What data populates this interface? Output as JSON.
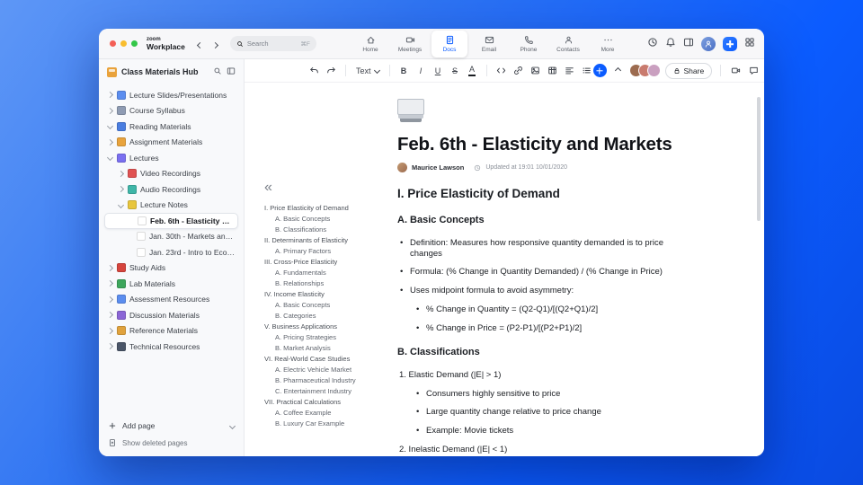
{
  "topbar": {
    "logo_top": "zoom",
    "logo_bottom": "Workplace",
    "search_placeholder": "Search",
    "search_shortcut": "⌘F",
    "traffic_lights": [
      {
        "name": "close",
        "color": "#f45f56"
      },
      {
        "name": "minimize",
        "color": "#f8bd2e"
      },
      {
        "name": "zoom",
        "color": "#33c748"
      }
    ],
    "tabs": [
      {
        "label": "Home",
        "icon": "home-icon",
        "active": false
      },
      {
        "label": "Meetings",
        "icon": "meetings-icon",
        "active": false
      },
      {
        "label": "Docs",
        "icon": "docs-icon",
        "active": true
      },
      {
        "label": "Email",
        "icon": "email-icon",
        "active": false
      },
      {
        "label": "Phone",
        "icon": "phone-icon",
        "active": false
      },
      {
        "label": "Contacts",
        "icon": "contacts-icon",
        "active": false
      },
      {
        "label": "More",
        "icon": "more-icon",
        "active": false
      }
    ],
    "accent": "#0b5cff"
  },
  "sidebar": {
    "title": "Class Materials Hub",
    "items": [
      {
        "label": "Lecture Slides/Presentations",
        "level": 0,
        "expandable": true,
        "expanded": false,
        "icon": "presentation-icon",
        "icon_color": "#5b8def"
      },
      {
        "label": "Course Syllabus",
        "level": 0,
        "expandable": true,
        "expanded": false,
        "icon": "syllabus-icon",
        "icon_color": "#8e9bb3"
      },
      {
        "label": "Reading Materials",
        "level": 0,
        "expandable": true,
        "expanded": true,
        "icon": "book-icon",
        "icon_color": "#4a7de0"
      },
      {
        "label": "Assignment Materials",
        "level": 0,
        "expandable": true,
        "expanded": false,
        "icon": "assignment-icon",
        "icon_color": "#e8a33d"
      },
      {
        "label": "Lectures",
        "level": 0,
        "expandable": true,
        "expanded": true,
        "icon": "lectures-icon",
        "icon_color": "#7a6ff0"
      },
      {
        "label": "Video Recordings",
        "level": 1,
        "expandable": true,
        "expanded": false,
        "icon": "video-icon",
        "icon_color": "#e05252"
      },
      {
        "label": "Audio Recordings",
        "level": 1,
        "expandable": true,
        "expanded": false,
        "icon": "audio-icon",
        "icon_color": "#3fb6a8"
      },
      {
        "label": "Lecture Notes",
        "level": 1,
        "expandable": true,
        "expanded": true,
        "icon": "notes-icon",
        "icon_color": "#e8c63d"
      },
      {
        "label": "Feb. 6th - Elasticity and M...",
        "level": 2,
        "selected": true,
        "icon": "page-icon",
        "icon_color": "#ffffff"
      },
      {
        "label": "Jan. 30th - Markets and P...",
        "level": 2,
        "icon": "page-icon",
        "icon_color": "#ffffff"
      },
      {
        "label": "Jan. 23rd - Intro to Econo...",
        "level": 2,
        "icon": "page-icon",
        "icon_color": "#ffffff"
      },
      {
        "label": "Study Aids",
        "level": 0,
        "expandable": true,
        "expanded": false,
        "icon": "study-icon",
        "icon_color": "#d6453d"
      },
      {
        "label": "Lab Materials",
        "level": 0,
        "expandable": true,
        "expanded": false,
        "icon": "lab-icon",
        "icon_color": "#3da65c"
      },
      {
        "label": "Assessment Resources",
        "level": 0,
        "expandable": true,
        "expanded": false,
        "icon": "assessment-icon",
        "icon_color": "#5b8def"
      },
      {
        "label": "Discussion Materials",
        "level": 0,
        "expandable": true,
        "expanded": false,
        "icon": "discussion-icon",
        "icon_color": "#8a65d6"
      },
      {
        "label": "Reference Materials",
        "level": 0,
        "expandable": true,
        "expanded": false,
        "icon": "reference-icon",
        "icon_color": "#e0a23d"
      },
      {
        "label": "Technical Resources",
        "level": 0,
        "expandable": true,
        "expanded": false,
        "icon": "technical-icon",
        "icon_color": "#4a5568"
      }
    ],
    "footer": {
      "add_page": "Add page",
      "show_deleted": "Show deleted pages"
    }
  },
  "doc_toolbar": {
    "text_style_label": "Text",
    "bold_label": "B",
    "italic_label": "I",
    "underline_label": "U",
    "strike_label": "S",
    "color_label": "A",
    "share_label": "Share",
    "collaborators": [
      {
        "name": "collaborator-1",
        "color": "#9c6b4f"
      },
      {
        "name": "collaborator-2",
        "color": "#c97b6e"
      },
      {
        "name": "collaborator-3",
        "color": "#caa0c0"
      }
    ]
  },
  "outline": {
    "collapse_icon": "«",
    "items": [
      {
        "label": "I. Price Elasticity of Demand",
        "level": 0
      },
      {
        "label": "A. Basic Concepts",
        "level": 1
      },
      {
        "label": "B. Classifications",
        "level": 1
      },
      {
        "label": "II. Determinants of Elasticity",
        "level": 0
      },
      {
        "label": "A. Primary Factors",
        "level": 1
      },
      {
        "label": "III. Cross-Price Elasticity",
        "level": 0
      },
      {
        "label": "A. Fundamentals",
        "level": 1
      },
      {
        "label": "B. Relationships",
        "level": 1
      },
      {
        "label": "IV. Income Elasticity",
        "level": 0
      },
      {
        "label": "A. Basic Concepts",
        "level": 1
      },
      {
        "label": "B. Categories",
        "level": 1
      },
      {
        "label": "V. Business Applications",
        "level": 0
      },
      {
        "label": "A. Pricing Strategies",
        "level": 1
      },
      {
        "label": "B. Market Analysis",
        "level": 1
      },
      {
        "label": "VI. Real-World Case Studies",
        "level": 0
      },
      {
        "label": "A. Electric Vehicle Market",
        "level": 1
      },
      {
        "label": "B. Pharmaceutical Industry",
        "level": 1
      },
      {
        "label": "C. Entertainment Industry",
        "level": 1
      },
      {
        "label": "VII. Practical Calculations",
        "level": 0
      },
      {
        "label": "A. Coffee Example",
        "level": 1
      },
      {
        "label": "B. Luxury Car Example",
        "level": 1
      }
    ]
  },
  "doc": {
    "title": "Feb. 6th - Elasticity and Markets",
    "author": "Maurice Lawson",
    "updated": "Updated at 19:01 10/01/2020",
    "blocks": [
      {
        "type": "h2",
        "text": "I. Price Elasticity of Demand"
      },
      {
        "type": "h3",
        "text": "A. Basic Concepts"
      },
      {
        "type": "b1",
        "text": "Definition: Measures how responsive quantity demanded is to price changes"
      },
      {
        "type": "b1",
        "text": "Formula: (% Change in Quantity Demanded) / (% Change in Price)"
      },
      {
        "type": "b1",
        "text": "Uses midpoint formula to avoid asymmetry:"
      },
      {
        "type": "b2",
        "text": "% Change in Quantity = (Q2-Q1)/[(Q2+Q1)/2]"
      },
      {
        "type": "b2",
        "text": "% Change in Price = (P2-P1)/[(P2+P1)/2]"
      },
      {
        "type": "h3",
        "text": "B. Classifications"
      },
      {
        "type": "n1",
        "text": "1. Elastic Demand (|E| > 1)"
      },
      {
        "type": "b2",
        "text": "Consumers highly sensitive to price"
      },
      {
        "type": "b2",
        "text": "Large quantity change relative to price change"
      },
      {
        "type": "b2",
        "text": "Example: Movie tickets"
      },
      {
        "type": "n1",
        "text": "2. Inelastic Demand (|E| < 1)"
      }
    ]
  }
}
